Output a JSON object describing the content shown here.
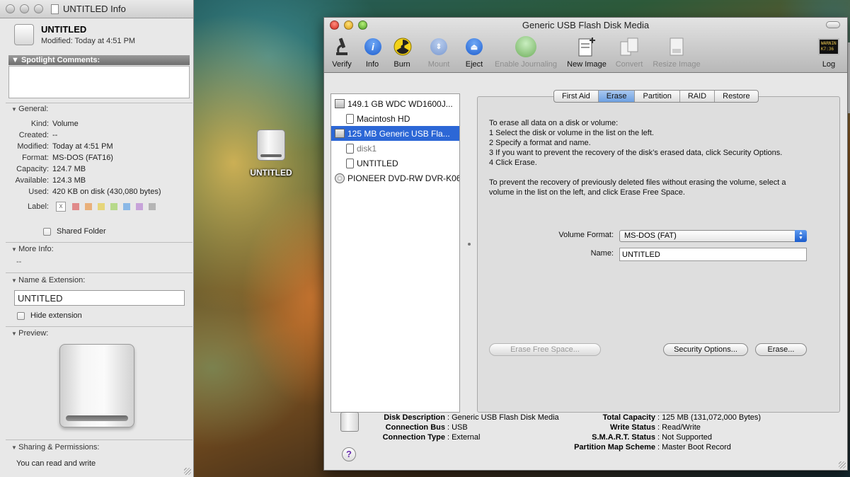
{
  "info_window": {
    "title": "UNTITLED Info",
    "name": "UNTITLED",
    "modified": "Modified: Today at 4:51 PM",
    "spotlight_header": "Spotlight Comments:",
    "general_header": "General:",
    "general": [
      {
        "key": "Kind:",
        "value": "Volume"
      },
      {
        "key": "Created:",
        "value": "--"
      },
      {
        "key": "Modified:",
        "value": "Today at 4:51 PM"
      },
      {
        "key": "Format:",
        "value": "MS-DOS (FAT16)"
      },
      {
        "key": "Capacity:",
        "value": "124.7 MB"
      },
      {
        "key": "Available:",
        "value": "124.3 MB"
      },
      {
        "key": "Used:",
        "value": "420 KB on disk (430,080 bytes)"
      }
    ],
    "label_key": "Label:",
    "label_clear": "x",
    "label_colors": [
      "#e08a8a",
      "#e9b07a",
      "#e6d67a",
      "#b7d98a",
      "#8ab8e6",
      "#c7a3d9",
      "#b5b5b5"
    ],
    "shared_folder": "Shared Folder",
    "more_info_header": "More Info:",
    "more_info_value": "--",
    "name_ext_header": "Name & Extension:",
    "name_field": "UNTITLED",
    "hide_extension": "Hide extension",
    "preview_header": "Preview:",
    "sharing_header": "Sharing & Permissions:",
    "sharing_text": "You can read and write"
  },
  "desktop": {
    "icon_label": "UNTITLED"
  },
  "disk_utility": {
    "title": "Generic USB Flash Disk Media",
    "toolbar": [
      {
        "label": "Verify",
        "enabled": true,
        "icon": "microscope-icon"
      },
      {
        "label": "Info",
        "enabled": true,
        "icon": "info-icon"
      },
      {
        "label": "Burn",
        "enabled": true,
        "icon": "radiation-icon"
      },
      {
        "label": "Mount",
        "enabled": false,
        "icon": "mount-icon"
      },
      {
        "label": "Eject",
        "enabled": true,
        "icon": "eject-icon"
      },
      {
        "label": "Enable Journaling",
        "enabled": false,
        "icon": "journaling-icon"
      },
      {
        "label": "New Image",
        "enabled": true,
        "icon": "new-image-icon"
      },
      {
        "label": "Convert",
        "enabled": false,
        "icon": "convert-icon"
      },
      {
        "label": "Resize Image",
        "enabled": false,
        "icon": "resize-image-icon"
      },
      {
        "label": "Log",
        "enabled": true,
        "icon": "log-icon"
      }
    ],
    "log_icon_text": "WARNIN\nK7:36",
    "disks": [
      {
        "label": "149.1 GB WDC WD1600J...",
        "level": 0,
        "icon": "hard-disk-icon",
        "selected": false,
        "dim": false
      },
      {
        "label": "Macintosh HD",
        "level": 1,
        "icon": "volume-icon",
        "selected": false,
        "dim": false
      },
      {
        "label": "125 MB Generic USB Fla...",
        "level": 0,
        "icon": "usb-disk-icon",
        "selected": true,
        "dim": false
      },
      {
        "label": "disk1",
        "level": 1,
        "icon": "volume-icon",
        "selected": false,
        "dim": true
      },
      {
        "label": "UNTITLED",
        "level": 1,
        "icon": "volume-icon",
        "selected": false,
        "dim": false
      },
      {
        "label": "PIONEER DVD-RW DVR-K06",
        "level": 0,
        "icon": "dvd-icon",
        "selected": false,
        "dim": false
      }
    ],
    "tabs": [
      "First Aid",
      "Erase",
      "Partition",
      "RAID",
      "Restore"
    ],
    "active_tab": "Erase",
    "instructions": [
      "To erase all data on a disk or volume:",
      "1 Select the disk or volume in the list on the left.",
      "2 Specify a format and name.",
      "3 If you want to prevent the recovery of the disk’s erased data, click Security Options.",
      "4 Click Erase.",
      "",
      "To prevent the recovery of previously deleted files without erasing the volume, select a",
      "volume in the list on the left, and click Erase Free Space."
    ],
    "volume_format_label": "Volume Format:",
    "volume_format_value": "MS-DOS (FAT)",
    "name_label": "Name:",
    "name_value": "UNTITLED",
    "buttons": {
      "erase_free_space": "Erase Free Space...",
      "security_options": "Security Options...",
      "erase": "Erase..."
    },
    "info_left": [
      {
        "key": "Disk Description",
        "value": "Generic USB Flash Disk Media"
      },
      {
        "key": "Connection Bus",
        "value": "USB"
      },
      {
        "key": "Connection Type",
        "value": "External"
      }
    ],
    "info_right": [
      {
        "key": "Total Capacity",
        "value": "125 MB (131,072,000 Bytes)"
      },
      {
        "key": "Write Status",
        "value": "Read/Write"
      },
      {
        "key": "S.M.A.R.T. Status",
        "value": "Not Supported"
      },
      {
        "key": "Partition Map Scheme",
        "value": "Master Boot Record"
      }
    ],
    "help": "?"
  }
}
